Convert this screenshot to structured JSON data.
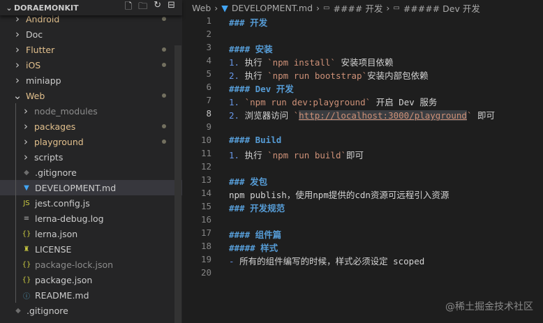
{
  "sidebar": {
    "title": "DORAEMONKIT",
    "tools": [
      "new-file",
      "new-folder",
      "refresh",
      "collapse-all"
    ],
    "items": [
      {
        "label": "Android",
        "type": "folder",
        "open": false,
        "depth": 0,
        "status": "mod",
        "dot": true
      },
      {
        "label": "Doc",
        "type": "folder",
        "open": false,
        "depth": 0,
        "status": "",
        "dot": false
      },
      {
        "label": "Flutter",
        "type": "folder",
        "open": false,
        "depth": 0,
        "status": "mod",
        "dot": true
      },
      {
        "label": "iOS",
        "type": "folder",
        "open": false,
        "depth": 0,
        "status": "mod",
        "dot": true
      },
      {
        "label": "miniapp",
        "type": "folder",
        "open": false,
        "depth": 0,
        "status": "",
        "dot": false
      },
      {
        "label": "Web",
        "type": "folder",
        "open": true,
        "depth": 0,
        "status": "mod",
        "dot": true
      },
      {
        "label": "node_modules",
        "type": "folder",
        "open": false,
        "depth": 1,
        "status": "ign",
        "dot": false
      },
      {
        "label": "packages",
        "type": "folder",
        "open": false,
        "depth": 1,
        "status": "mod",
        "dot": true
      },
      {
        "label": "playground",
        "type": "folder",
        "open": false,
        "depth": 1,
        "status": "mod",
        "dot": true
      },
      {
        "label": "scripts",
        "type": "folder",
        "open": false,
        "depth": 1,
        "status": "",
        "dot": false
      },
      {
        "label": ".gitignore",
        "type": "file",
        "icon": "◆",
        "iconColor": "#6d6d6d",
        "depth": 1,
        "status": ""
      },
      {
        "label": "DEVELOPMENT.md",
        "type": "file",
        "icon": "▼",
        "iconColor": "#42a5f5",
        "depth": 1,
        "status": "",
        "selected": true
      },
      {
        "label": "jest.config.js",
        "type": "file",
        "icon": "JS",
        "iconColor": "#cbcb41",
        "depth": 1,
        "status": ""
      },
      {
        "label": "lerna-debug.log",
        "type": "file",
        "icon": "≡",
        "iconColor": "#aaaaaa",
        "depth": 1,
        "status": ""
      },
      {
        "label": "lerna.json",
        "type": "file",
        "icon": "{}",
        "iconColor": "#cbcb41",
        "depth": 1,
        "status": ""
      },
      {
        "label": "LICENSE",
        "type": "file",
        "icon": "♜",
        "iconColor": "#cbcb41",
        "depth": 1,
        "status": ""
      },
      {
        "label": "package-lock.json",
        "type": "file",
        "icon": "{}",
        "iconColor": "#cbcb41",
        "depth": 1,
        "status": "ign"
      },
      {
        "label": "package.json",
        "type": "file",
        "icon": "{}",
        "iconColor": "#cbcb41",
        "depth": 1,
        "status": ""
      },
      {
        "label": "README.md",
        "type": "file",
        "icon": "ⓘ",
        "iconColor": "#519aba",
        "depth": 1,
        "status": ""
      },
      {
        "label": ".gitignore",
        "type": "file",
        "icon": "◆",
        "iconColor": "#6d6d6d",
        "depth": 0,
        "status": ""
      }
    ]
  },
  "breadcrumbs": [
    "Web",
    "DEVELOPMENT.md",
    "#### 开发",
    "##### Dev 开发"
  ],
  "editor": {
    "current_line": 8,
    "lines": [
      [
        [
          "h",
          "### 开发"
        ]
      ],
      [],
      [
        [
          "h",
          "#### 安装"
        ]
      ],
      [
        [
          "n",
          "1. "
        ],
        [
          "t",
          "执行 "
        ],
        [
          "c",
          "`npm install`"
        ],
        [
          "t",
          " 安装项目依赖"
        ]
      ],
      [
        [
          "n",
          "2. "
        ],
        [
          "t",
          "执行 "
        ],
        [
          "c",
          "`npm run bootstrap`"
        ],
        [
          "t",
          "安装内部包依赖"
        ]
      ],
      [
        [
          "h",
          "#### Dev 开发"
        ]
      ],
      [
        [
          "n",
          "1. "
        ],
        [
          "c",
          "`npm run dev:playground`"
        ],
        [
          "t",
          " 开启 Dev 服务"
        ]
      ],
      [
        [
          "n",
          "2. "
        ],
        [
          "t",
          "浏览器访问 "
        ],
        [
          "c",
          "`"
        ],
        [
          "u",
          "http://localhost:3000/playground"
        ],
        [
          "c",
          "`"
        ],
        [
          "t",
          " 即可"
        ]
      ],
      [],
      [
        [
          "h",
          "#### Build"
        ]
      ],
      [
        [
          "n",
          "1. "
        ],
        [
          "t",
          "执行 "
        ],
        [
          "c",
          "`npm run build`"
        ],
        [
          "t",
          "即可"
        ]
      ],
      [],
      [
        [
          "h",
          "### 发包"
        ]
      ],
      [
        [
          "t",
          "npm publish，使用npm提供的cdn资源可远程引入资源"
        ]
      ],
      [
        [
          "h",
          "### 开发规范"
        ]
      ],
      [],
      [
        [
          "h",
          "#### 组件篇"
        ]
      ],
      [
        [
          "h",
          "##### 样式"
        ]
      ],
      [
        [
          "n",
          "- "
        ],
        [
          "t",
          "所有的组件编写的时候，样式必须设定 scoped"
        ]
      ],
      []
    ]
  },
  "watermark": "@稀土掘金技术社区"
}
